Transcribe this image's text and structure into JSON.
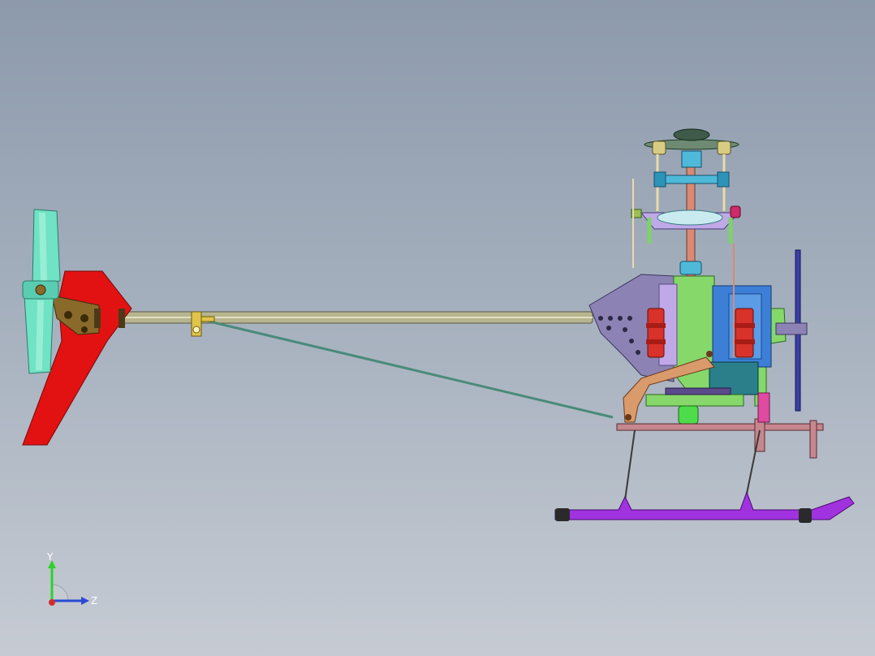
{
  "viewport": {
    "background_top": "#8d9aac",
    "background_bottom": "#c6cbd3"
  },
  "model": {
    "colors": {
      "tail_fin": "#e21212",
      "tail_blades": "#6fe3c4",
      "tail_boom": "#b7b58f",
      "landing_skid": "#a032e0",
      "frame_green": "#86d86a",
      "frame_purple": "#8c83b4",
      "frame_blue": "#3d7fd6",
      "servo_red": "#d8322b",
      "shaft_salmon": "#d88a74",
      "swashplate_cyan": "#4fb9d9",
      "control_rod": "#4a8a7a",
      "bellcrank_orange": "#d99a6c"
    }
  },
  "triad": {
    "y_label": "Y",
    "z_label": "Z",
    "y_color": "#2bd32b",
    "z_color": "#2b4ad3",
    "x_color": "#d32b2b"
  }
}
